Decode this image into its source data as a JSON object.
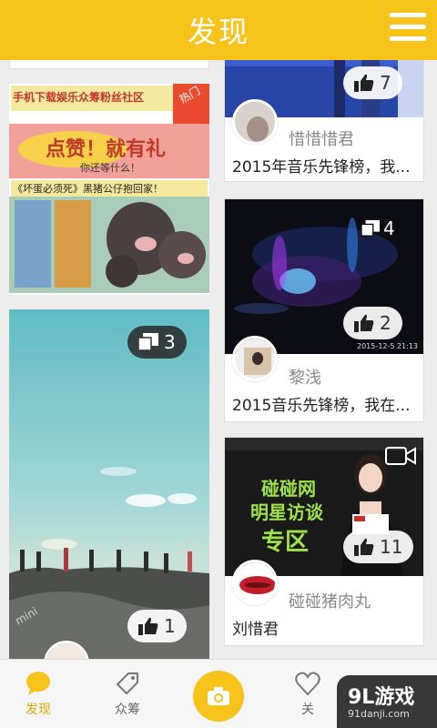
{
  "header": {
    "title": "发现"
  },
  "cards": [
    {
      "likes": "7",
      "user": "惜惜惜君",
      "title": "2015年音乐先锋榜，我..."
    },
    {
      "banner_title": "手机下载娱乐众筹粉丝社区",
      "banner_badge": "热门",
      "promo_main": "点赞！就有礼",
      "promo_sub": "你还等什么！",
      "promo_bottom": "《坏蛋必须死》黑猪公仔抱回家！"
    },
    {
      "images": "4",
      "likes": "2",
      "date": "2015-12-5 21:13",
      "user": "黎浅",
      "title": "2015音乐先锋榜，我在..."
    },
    {
      "images": "3",
      "likes": "1",
      "photo_tag": "mini"
    },
    {
      "likes": "11",
      "poster_line1": "碰碰网",
      "poster_line2": "明星访谈",
      "poster_line3": "专区",
      "user": "碰碰猪肉丸",
      "title": "刘惜君"
    }
  ],
  "tabbar": {
    "discover": "发现",
    "crowdfund": "众筹",
    "third": "关"
  },
  "watermark": {
    "main": "9L游戏",
    "sub": "91danji.com"
  }
}
